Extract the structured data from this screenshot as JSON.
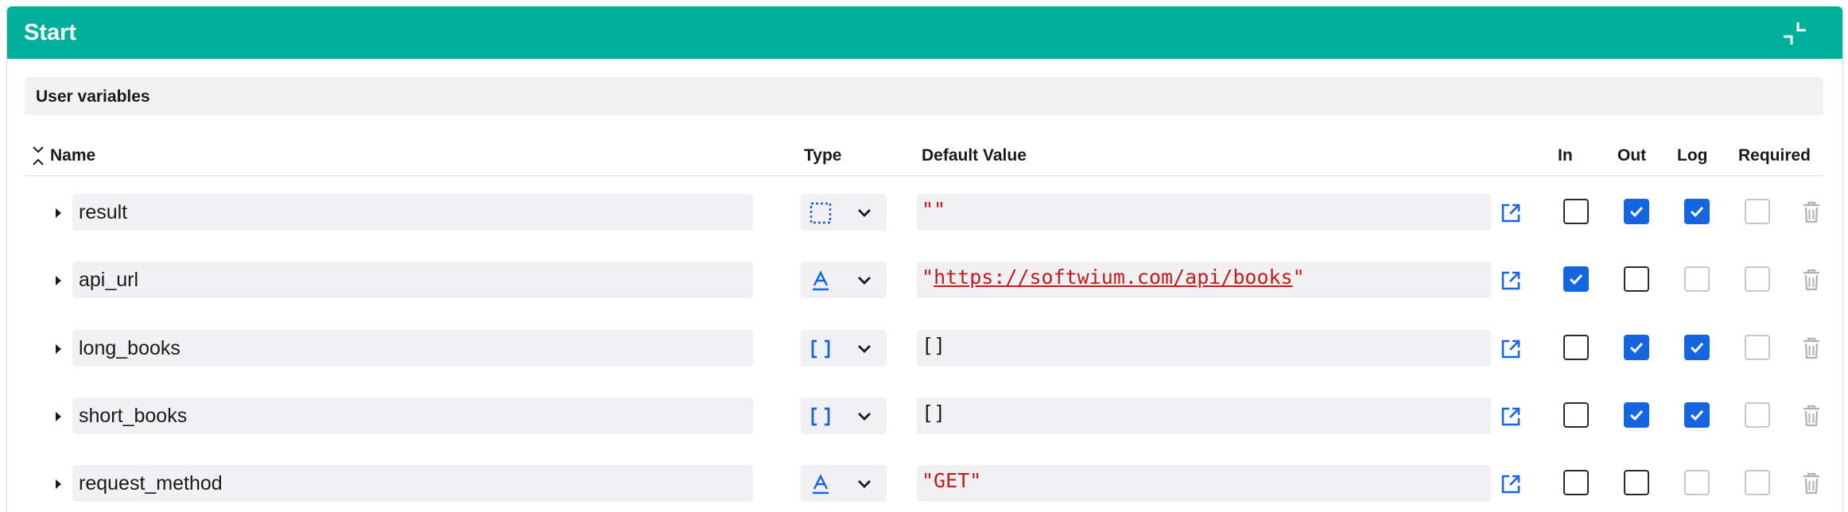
{
  "header": {
    "title": "Start",
    "collapse_icon": "collapse-arrows-icon"
  },
  "section": {
    "title": "User variables"
  },
  "columns": {
    "name": "Name",
    "type": "Type",
    "default_value": "Default Value",
    "in": "In",
    "out": "Out",
    "log": "Log",
    "required": "Required"
  },
  "colors": {
    "header": "#00b09b",
    "checkbox_checked": "#1565e0",
    "string_value": "#c41a1a",
    "type_icon": "#1565e0"
  },
  "rows": [
    {
      "name": "result",
      "type_icon": "any-type-icon",
      "default_value": "\"\"",
      "value_style": "string",
      "in": false,
      "out": true,
      "log": true,
      "required": false
    },
    {
      "name": "api_url",
      "type_icon": "text-type-icon",
      "default_value": "\"https://softwium.com/api/books\"",
      "value_style": "link",
      "in": true,
      "out": false,
      "log": false,
      "required": false
    },
    {
      "name": "long_books",
      "type_icon": "list-type-icon",
      "default_value": "[]",
      "value_style": "plain",
      "in": false,
      "out": true,
      "log": true,
      "required": false
    },
    {
      "name": "short_books",
      "type_icon": "list-type-icon",
      "default_value": "[]",
      "value_style": "plain",
      "in": false,
      "out": true,
      "log": true,
      "required": false
    },
    {
      "name": "request_method",
      "type_icon": "text-type-icon",
      "default_value": "\"GET\"",
      "value_style": "string",
      "in": false,
      "out": false,
      "log": false,
      "required": false
    }
  ]
}
